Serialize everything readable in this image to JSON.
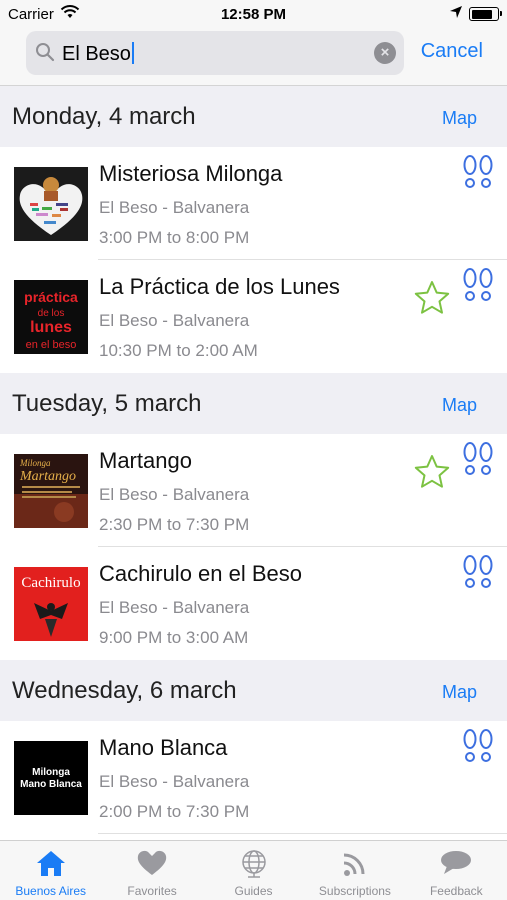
{
  "status_bar": {
    "carrier": "Carrier",
    "time": "12:58 PM",
    "battery_level": 0.85
  },
  "search": {
    "value": "El Beso",
    "cancel_label": "Cancel"
  },
  "sections": [
    {
      "day": "Monday, 4 march",
      "map_label": "Map",
      "events": [
        {
          "title": "Misteriosa Milonga",
          "venue": "El Beso - Balvanera",
          "hours": "3:00 PM to 8:00 PM",
          "favorite": false
        },
        {
          "title": "La Práctica de los Lunes",
          "venue": "El Beso - Balvanera",
          "hours": "10:30 PM to 2:00 AM",
          "favorite": true
        }
      ]
    },
    {
      "day": "Tuesday, 5 march",
      "map_label": "Map",
      "events": [
        {
          "title": "Martango",
          "venue": "El Beso - Balvanera",
          "hours": "2:30 PM to 7:30 PM",
          "favorite": true
        },
        {
          "title": "Cachirulo en el Beso",
          "venue": "El Beso - Balvanera",
          "hours": "9:00 PM to 3:00 AM",
          "favorite": false
        }
      ]
    },
    {
      "day": "Wednesday, 6 march",
      "map_label": "Map",
      "events": [
        {
          "title": "Mano Blanca",
          "venue": "El Beso - Balvanera",
          "hours": "2:00 PM to 7:30 PM",
          "favorite": false
        }
      ]
    }
  ],
  "thumbnails": {
    "practica": {
      "line1": "práctica",
      "line2": "de los",
      "line3": "lunes",
      "line4": "en el beso"
    },
    "martango": {
      "line1": "Milonga",
      "line2": "Martango"
    },
    "cachirulo": {
      "line1": "Cachirulo"
    },
    "mano_blanca": {
      "line1": "Milonga",
      "line2": "Mano Blanca"
    }
  },
  "tabs": [
    {
      "label": "Buenos Aires",
      "icon": "house-icon",
      "active": true
    },
    {
      "label": "Favorites",
      "icon": "heart-icon",
      "active": false
    },
    {
      "label": "Guides",
      "icon": "globe-icon",
      "active": false
    },
    {
      "label": "Subscriptions",
      "icon": "rss-icon",
      "active": false
    },
    {
      "label": "Feedback",
      "icon": "speech-bubble-icon",
      "active": false
    }
  ],
  "colors": {
    "accent": "#1a7cf5",
    "favorite_star": "#7cc242",
    "footprints": "#3d6fe0",
    "tab_inactive": "#8e8e93",
    "section_bg": "#efeff4"
  }
}
